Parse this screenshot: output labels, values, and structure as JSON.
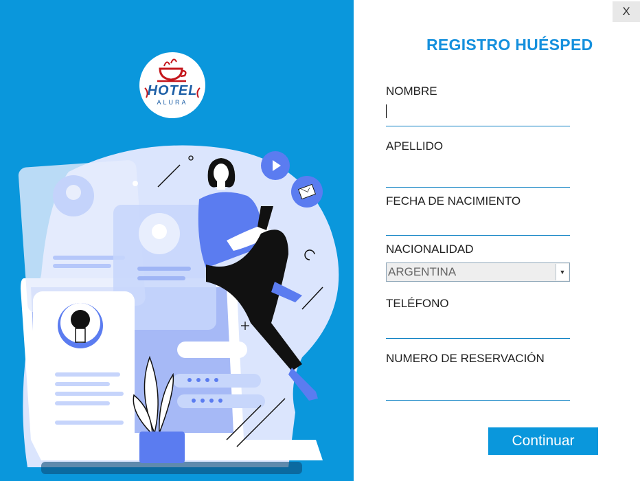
{
  "window": {
    "close_label": "X"
  },
  "logo": {
    "name": "HOTEL",
    "sub": "ALURA"
  },
  "form": {
    "title": "REGISTRO HUÉSPED",
    "fields": {
      "nombre": {
        "label": "NOMBRE",
        "value": ""
      },
      "apellido": {
        "label": "APELLIDO",
        "value": ""
      },
      "fecha": {
        "label": "FECHA DE NACIMIENTO",
        "value": ""
      },
      "nacionalidad": {
        "label": "NACIONALIDAD",
        "selected": "ARGENTINA"
      },
      "telefono": {
        "label": "TELÉFONO",
        "value": ""
      },
      "reserva": {
        "label": "NUMERO DE RESERVACIÓN",
        "value": ""
      }
    },
    "submit_label": "Continuar"
  },
  "colors": {
    "accent": "#0a97dc",
    "title": "#1590dd",
    "illustration_blue": "#5b7cf0",
    "illustration_light": "#c7d6fb"
  },
  "icons": {
    "close": "close-icon",
    "dropdown": "chevron-down-icon",
    "play": "play-icon",
    "mail": "mail-icon"
  }
}
